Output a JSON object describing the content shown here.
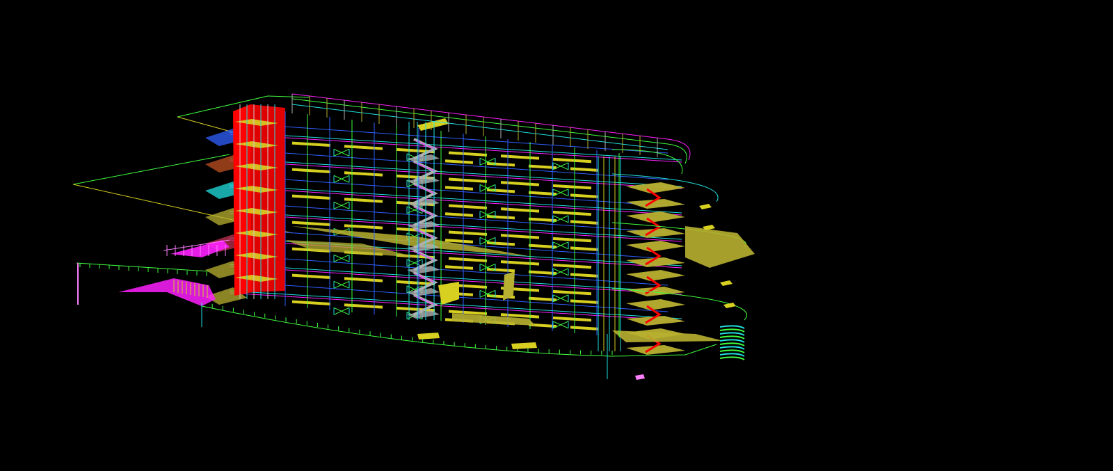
{
  "viewport": {
    "background": "#000000"
  },
  "palette": {
    "yellow": "#d8d020",
    "olive": "#b8b030",
    "red": "#ff0000",
    "magenta": "#ff20ff",
    "cyan": "#20e0e0",
    "green": "#40ff40",
    "blue": "#3060ff",
    "white": "#d0d0d0",
    "gray": "#b0b0b0",
    "pink": "#ff80ff"
  },
  "model": {
    "floors": 7
  }
}
